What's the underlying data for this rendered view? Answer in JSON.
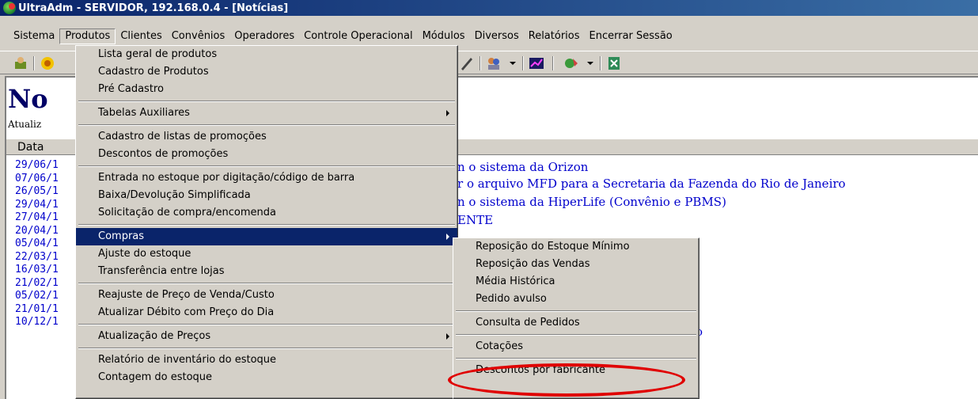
{
  "window": {
    "title": "UltraAdm - SERVIDOR, 192.168.0.4 - [Notícias]"
  },
  "menubar": [
    "Sistema",
    "Produtos",
    "Clientes",
    "Convênios",
    "Operadores",
    "Controle Operacional",
    "Módulos",
    "Diversos",
    "Relatórios",
    "Encerrar Sessão"
  ],
  "page": {
    "title": "No",
    "updated_label": "Atualiz",
    "header_date": "Data"
  },
  "dates": [
    "29/06/1",
    "07/06/1",
    "26/05/1",
    "29/04/1",
    "27/04/1",
    "20/04/1",
    "05/04/1",
    "22/03/1",
    "16/03/1",
    "21/02/1",
    "05/02/1",
    "21/01/1",
    "10/12/1"
  ],
  "news": [
    "n o sistema da Orizon",
    "r o arquivo MFD para a Secretaria da Fazenda do Rio de Janeiro",
    "n o sistema da HiperLife (Convênio e PBMS)",
    "ENTE",
    "ão"
  ],
  "produtos_menu": {
    "items": [
      "Lista geral de produtos",
      "Cadastro de Produtos",
      "Pré Cadastro",
      "Tabelas Auxiliares",
      "Cadastro de listas de promoções",
      "Descontos de promoções",
      "Entrada no estoque por digitação/código de barra",
      "Baixa/Devolução Simplificada",
      "Solicitação de compra/encomenda",
      "Compras",
      "Ajuste do estoque",
      "Transferência entre lojas",
      "Reajuste de Preço de Venda/Custo",
      "Atualizar Débito com Preço do Dia",
      "Atualização de Preços",
      "Relatório de inventário do estoque",
      "Contagem do estoque"
    ]
  },
  "compras_menu": {
    "items": [
      "Reposição do Estoque Mínimo",
      "Reposição das Vendas",
      "Média Histórica",
      "Pedido avulso",
      "Consulta de Pedidos",
      "Cotações",
      "Descontos por fabricante"
    ]
  },
  "colors": {
    "titlebar": "#0a246a",
    "menu_highlight": "#0a246a",
    "link": "#0000cc",
    "annotation": "#e00000"
  }
}
